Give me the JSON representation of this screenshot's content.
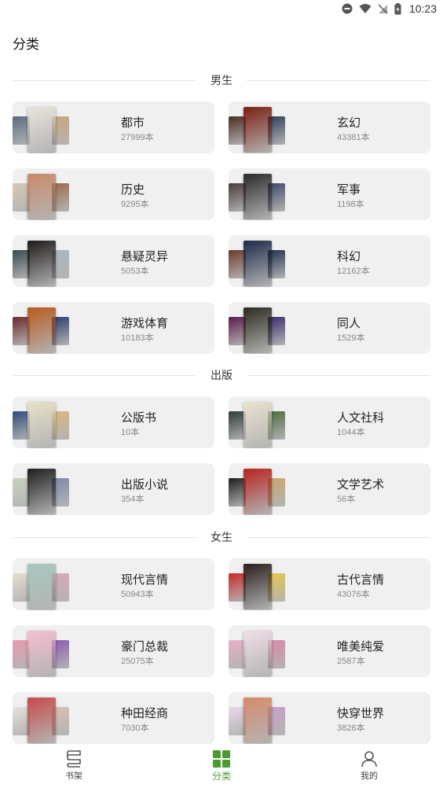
{
  "status_bar": {
    "time": "10:23"
  },
  "page": {
    "title": "分类"
  },
  "sections": [
    {
      "title": "男生",
      "items": [
        {
          "name": "都市",
          "count": "27999本",
          "covers": [
            "#5a6b7e",
            "#e9e4dd",
            "#c9a57b"
          ]
        },
        {
          "name": "玄幻",
          "count": "43381本",
          "covers": [
            "#4a2c1e",
            "#7a1f12",
            "#2e3d5a"
          ]
        },
        {
          "name": "历史",
          "count": "9295本",
          "covers": [
            "#d8c9b5",
            "#c98a6b",
            "#9a6a48"
          ]
        },
        {
          "name": "军事",
          "count": "1198本",
          "covers": [
            "#4a3a3a",
            "#2a2a2a",
            "#3a4a6b"
          ]
        },
        {
          "name": "悬疑灵异",
          "count": "5053本",
          "covers": [
            "#3a4a52",
            "#1f1a1a",
            "#aab7c0"
          ]
        },
        {
          "name": "科幻",
          "count": "12162本",
          "covers": [
            "#6b3a2a",
            "#1e2a4a",
            "#20304a"
          ]
        },
        {
          "name": "游戏体育",
          "count": "10183本",
          "covers": [
            "#6b2a2a",
            "#b85a1e",
            "#2a3a6b"
          ]
        },
        {
          "name": "同人",
          "count": "1529本",
          "covers": [
            "#5a1a4a",
            "#2a2a1e",
            "#3a2a6b"
          ]
        }
      ]
    },
    {
      "title": "出版",
      "items": [
        {
          "name": "公版书",
          "count": "10本",
          "covers": [
            "#2e4a7a",
            "#e8e2c8",
            "#d9b77a"
          ]
        },
        {
          "name": "人文社科",
          "count": "1044本",
          "covers": [
            "#2e3a3a",
            "#ebe3d0",
            "#4a6b3a"
          ]
        },
        {
          "name": "出版小说",
          "count": "354本",
          "covers": [
            "#c7d4c0",
            "#1e1e1e",
            "#7a8aa8"
          ]
        },
        {
          "name": "文学艺术",
          "count": "56本",
          "covers": [
            "#1e1e1e",
            "#b8231e",
            "#c9a86b"
          ]
        }
      ]
    },
    {
      "title": "女生",
      "items": [
        {
          "name": "现代言情",
          "count": "50943本",
          "covers": [
            "#e8ddd2",
            "#a8c8c0",
            "#d8a8b8"
          ]
        },
        {
          "name": "古代言情",
          "count": "43076本",
          "covers": [
            "#c82a2a",
            "#2a1e1e",
            "#e8c84a"
          ]
        },
        {
          "name": "豪门总裁",
          "count": "25075本",
          "covers": [
            "#e89ab0",
            "#f4c0d0",
            "#8a5ab0"
          ]
        },
        {
          "name": "唯美纯爱",
          "count": "2587本",
          "covers": [
            "#e8b0c8",
            "#f0e0e8",
            "#d88aa8"
          ]
        },
        {
          "name": "种田经商",
          "count": "7030本",
          "covers": [
            "#e8e0d8",
            "#c84a4a",
            "#d8c0b0"
          ]
        },
        {
          "name": "快穿世界",
          "count": "3826本",
          "covers": [
            "#e8d8e8",
            "#d88a6a",
            "#c8a0c8"
          ]
        }
      ]
    }
  ],
  "bottom_nav": [
    {
      "label": "书架",
      "icon": "bookshelf-icon",
      "active": false
    },
    {
      "label": "分类",
      "icon": "category-grid-icon",
      "active": true
    },
    {
      "label": "我的",
      "icon": "profile-icon",
      "active": false
    }
  ],
  "colors": {
    "accent": "#4a9b2f",
    "card_bg": "#f0f0f0",
    "divider": "#e4e4e4"
  }
}
